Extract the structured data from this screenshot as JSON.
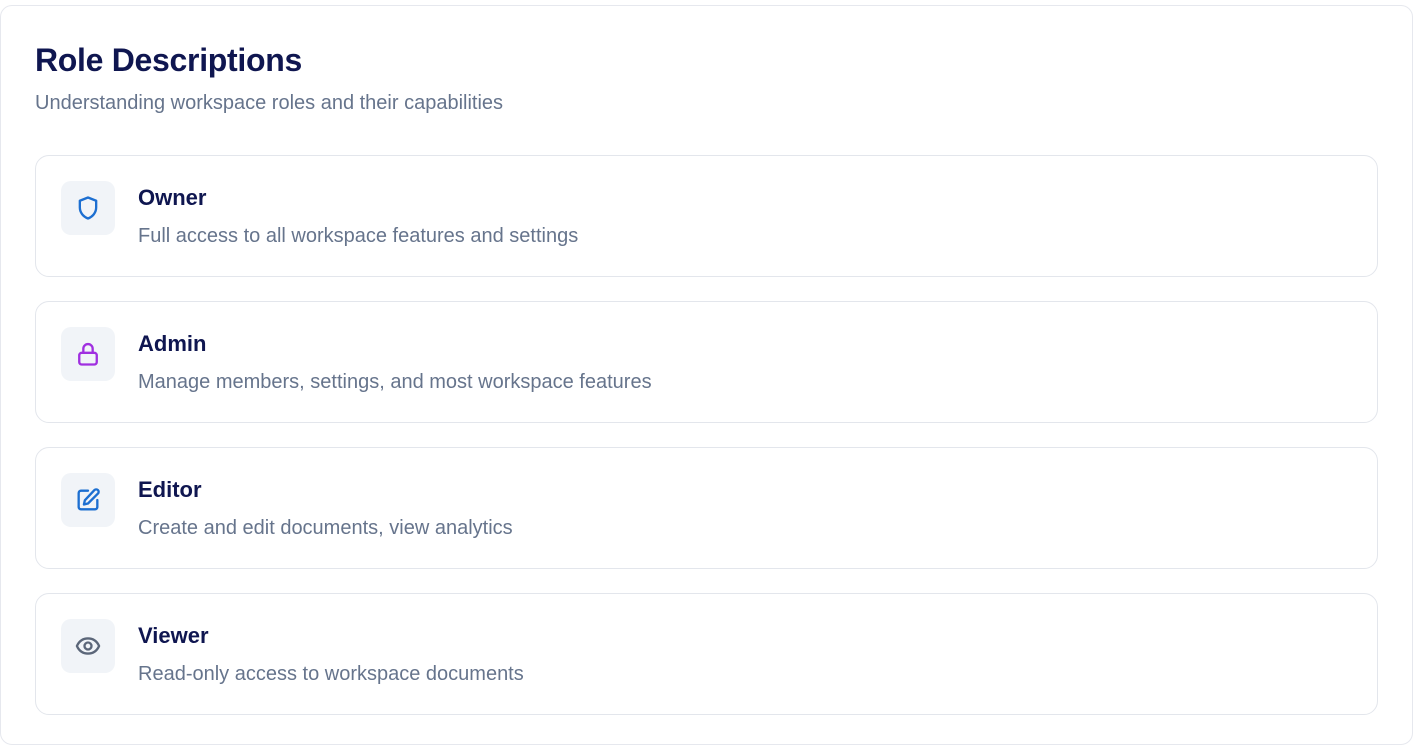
{
  "header": {
    "title": "Role Descriptions",
    "subtitle": "Understanding workspace roles and their capabilities"
  },
  "roles": [
    {
      "name": "Owner",
      "description": "Full access to all workspace features and settings",
      "icon": "shield-icon",
      "icon_color": "#1d6fd1"
    },
    {
      "name": "Admin",
      "description": "Manage members, settings, and most workspace features",
      "icon": "lock-icon",
      "icon_color": "#a02fe0"
    },
    {
      "name": "Editor",
      "description": "Create and edit documents, view analytics",
      "icon": "edit-icon",
      "icon_color": "#1d6fd1"
    },
    {
      "name": "Viewer",
      "description": "Read-only access to workspace documents",
      "icon": "eye-icon",
      "icon_color": "#5b6679"
    }
  ],
  "colors": {
    "heading": "#0f1650",
    "muted_text": "#66748c",
    "card_border": "#e3e6ec",
    "icon_bg": "#f1f4f8"
  }
}
